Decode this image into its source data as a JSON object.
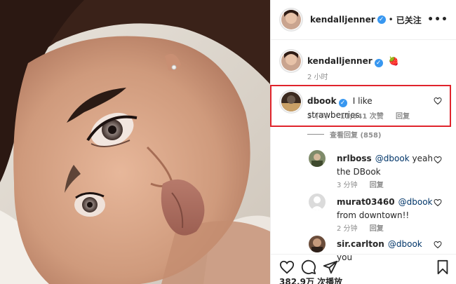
{
  "post": {
    "author": "kendalljenner",
    "follow_label": "已关注",
    "more_icon": "more-options-icon"
  },
  "caption": {
    "author": "kendalljenner",
    "emoji": "🍓",
    "time": "2 小时"
  },
  "highlighted_comment": {
    "author": "dbook",
    "text": "I like strawberries",
    "time": "2 小时",
    "likes": "11,641 次赞",
    "reply_label": "回复"
  },
  "view_replies": "查看回复 (858)",
  "replies": [
    {
      "author": "nrlboss",
      "mention": "@dbook",
      "text": " yeah",
      "text2": "the DBook",
      "time": "3 分钟",
      "reply_label": "回复"
    },
    {
      "author": "murat03460",
      "mention": "@dbook",
      "text": "",
      "text2": "from downtown!!",
      "time": "2 分钟",
      "reply_label": "回复"
    },
    {
      "author": "sir.carlton",
      "mention": "@dbook",
      "text": " you",
      "text2": "",
      "time": "",
      "reply_label": ""
    }
  ],
  "stats": {
    "views": "382.9万 次播放"
  },
  "colors": {
    "verified": "#3897f0",
    "highlight": "#e0242c",
    "link": "#003569",
    "muted": "#8e8e8e"
  }
}
